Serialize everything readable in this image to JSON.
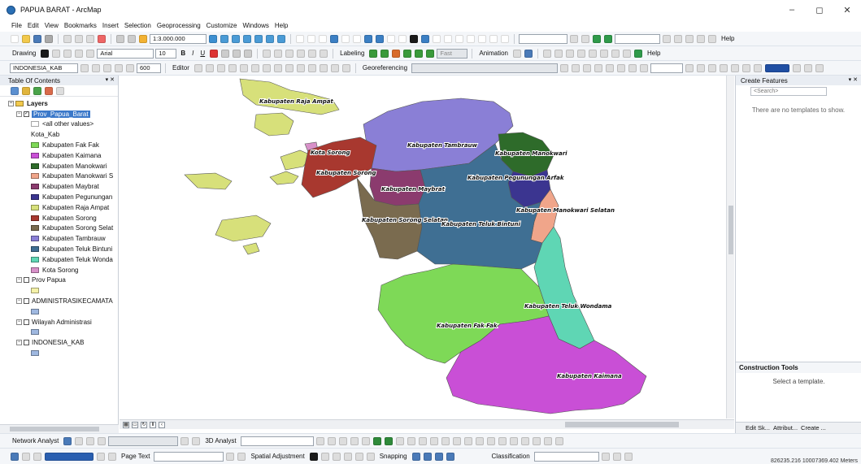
{
  "window": {
    "title": "PAPUA BARAT - ArcMap",
    "minimize": "–",
    "restore": "◻",
    "close": "✕"
  },
  "menu": [
    "File",
    "Edit",
    "View",
    "Bookmarks",
    "Insert",
    "Selection",
    "Geoprocessing",
    "Customize",
    "Windows",
    "Help"
  ],
  "toolbar1": {
    "scale": "1:3.000.000",
    "help": "Help"
  },
  "toolbar2": {
    "drawing": "Drawing",
    "font": "Arial",
    "font_size": "10",
    "labeling": "Labeling",
    "fast": "Fast",
    "animation": "Animation",
    "help": "Help"
  },
  "toolbar3": {
    "layer": "INDONESIA_KAB",
    "zoom": "600",
    "editor": "Editor",
    "georeferencing": "Georeferencing"
  },
  "toc": {
    "title": "Table Of Contents",
    "layers_group": "Layers",
    "prov_pb": "Prov_Papua_Barat",
    "all_other": "<all other values>",
    "field": "Kota_Kab",
    "classes": [
      {
        "label": "Kabupaten Fak Fak",
        "color": "#7ed957"
      },
      {
        "label": "Kabupaten Kaimana",
        "color": "#c94fd6"
      },
      {
        "label": "Kabupaten Manokwari",
        "color": "#2e6b2a"
      },
      {
        "label": "Kabupaten Manokwari S",
        "color": "#f0a58a"
      },
      {
        "label": "Kabupaten Maybrat",
        "color": "#8b3b6e"
      },
      {
        "label": "Kabupaten Pegunungan",
        "color": "#3b3590"
      },
      {
        "label": "Kabupaten Raja Ampat",
        "color": "#d7e07a"
      },
      {
        "label": "Kabupaten Sorong",
        "color": "#a8382f"
      },
      {
        "label": "Kabupaten Sorong Selat",
        "color": "#7a6b4f"
      },
      {
        "label": "Kabupaten Tambrauw",
        "color": "#8a7fd6"
      },
      {
        "label": "Kabupaten Teluk Bintuni",
        "color": "#3f6f93"
      },
      {
        "label": "Kabupaten Teluk Wonda",
        "color": "#5fd6b4"
      },
      {
        "label": "Kota Sorong",
        "color": "#d891c9"
      }
    ],
    "other_layers": [
      "Prov Papua",
      "ADMINISTRASIKECAMATA",
      "Wilayah Administrasi",
      "INDONESIA_KAB"
    ],
    "other_swatch_colors": [
      "#f4f1a8",
      "#9fb8e0",
      "#9fb8e0",
      "#9fb8e0"
    ]
  },
  "map": {
    "labels": {
      "raja_ampat": "Kabupaten Raja Ampat",
      "tambrauw": "Kabupaten Tambrauw",
      "kota_sorong": "Kota Sorong",
      "manokwari": "Kabupaten Manokwari",
      "sorong": "Kabupaten Sorong",
      "pegunungan_arfak": "Kabupaten Pegunungan Arfak",
      "maybrat": "Kabupaten Maybrat",
      "manokwari_selatan": "Kabupaten Manokwari Selatan",
      "sorong_selatan": "Kabupaten Sorong Selatan",
      "teluk_bintuni": "Kabupaten Teluk Bintuni",
      "teluk_wondama": "Kabupaten Teluk Wondama",
      "fak_fak": "Kabupaten Fak Fak",
      "kaimana": "Kabupaten Kaimana"
    }
  },
  "create_features": {
    "title": "Create Features",
    "search_placeholder": "<Search>",
    "empty_msg": "There are no templates to show.",
    "construction_title": "Construction Tools",
    "construction_msg": "Select a template.",
    "tabs": [
      "Edit Sk...",
      "Attribut...",
      "Create ..."
    ]
  },
  "bottom_toolbar1": {
    "network": "Network Analyst",
    "analyst3d": "3D Analyst"
  },
  "bottom_toolbar2": {
    "page_text": "Page Text",
    "spatial": "Spatial Adjustment",
    "snapping": "Snapping",
    "classification": "Classification"
  },
  "status": {
    "coords": "826235.216 10007369.402 Meters"
  }
}
